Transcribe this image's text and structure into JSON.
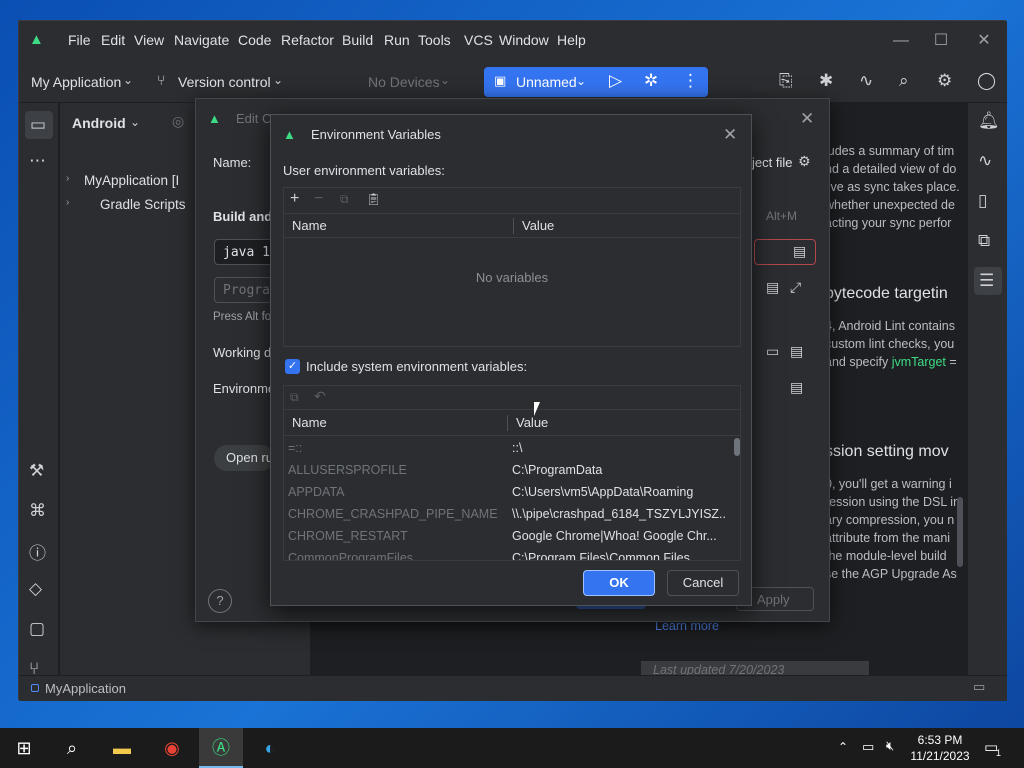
{
  "menu": [
    "File",
    "Edit",
    "View",
    "Navigate",
    "Code",
    "Refactor",
    "Build",
    "Run",
    "Tools",
    "VCS",
    "Window",
    "Help"
  ],
  "toolbar": {
    "project": "My Application",
    "vcs": "Version control",
    "devices": "No Devices",
    "run_config": "Unnamed"
  },
  "project_panel": {
    "view": "Android",
    "items": [
      "MyApplication [I",
      "Gradle Scripts"
    ]
  },
  "run_config_dialog": {
    "title": "Edit C",
    "name_label": "Name:",
    "store_label": "ject file",
    "build_section": "Build and",
    "java_field": "java 1",
    "program_placeholder": "Progra",
    "hint": "Press Alt fo",
    "working_label": "Working d",
    "env_label": "Environme",
    "open_button": "Open ru",
    "shortcut": "Alt+M",
    "apply": "Apply"
  },
  "doc": {
    "lines1": [
      "ludes a summary of tim",
      "nd a detailed view of do",
      "live as sync takes place.",
      "whether unexpected de",
      "acting your sync perfor"
    ],
    "heading1": "bytecode targetin",
    "lines2a": [
      "4, Android Lint contains",
      "custom lint checks, you"
    ],
    "line2c_pre": "and specify ",
    "line2c_link": "jvmTarget",
    "line2c_post": " =",
    "heading2": "ssion setting mov",
    "lines3": [
      "0, you'll get a warning i",
      "ression using the DSL in",
      "ary compression, you n",
      "attribute from the mani",
      "the module-level build",
      "se the AGP Upgrade As"
    ],
    "learn_more": "Learn more",
    "last_updated": "Last updated 7/20/2023"
  },
  "env_dialog": {
    "title": "Environment Variables",
    "user_label": "User environment variables:",
    "col_name": "Name",
    "col_value": "Value",
    "empty": "No variables",
    "include_label": "Include system environment variables:",
    "include_checked": true,
    "rows": [
      {
        "name": "=::",
        "value": "::\\"
      },
      {
        "name": "ALLUSERSPROFILE",
        "value": "C:\\ProgramData"
      },
      {
        "name": "APPDATA",
        "value": "C:\\Users\\vm5\\AppData\\Roaming"
      },
      {
        "name": "CHROME_CRASHPAD_PIPE_NAME",
        "value": "\\\\.\\pipe\\crashpad_6184_TSZYLJYISZ..."
      },
      {
        "name": "CHROME_RESTART",
        "value": "Google Chrome|Whoa! Google Chr..."
      },
      {
        "name": "CommonProgramFiles",
        "value": "C:\\Program Files\\Common Files"
      }
    ],
    "ok": "OK",
    "cancel": "Cancel"
  },
  "statusbar": {
    "project": "MyApplication"
  },
  "taskbar": {
    "time": "6:53 PM",
    "date": "11/21/2023",
    "notifications": "1"
  },
  "colors": {
    "accent": "#3574f0",
    "link": "#548af7",
    "ide_bg": "#1e1f22",
    "panel_bg": "#2b2d30"
  }
}
